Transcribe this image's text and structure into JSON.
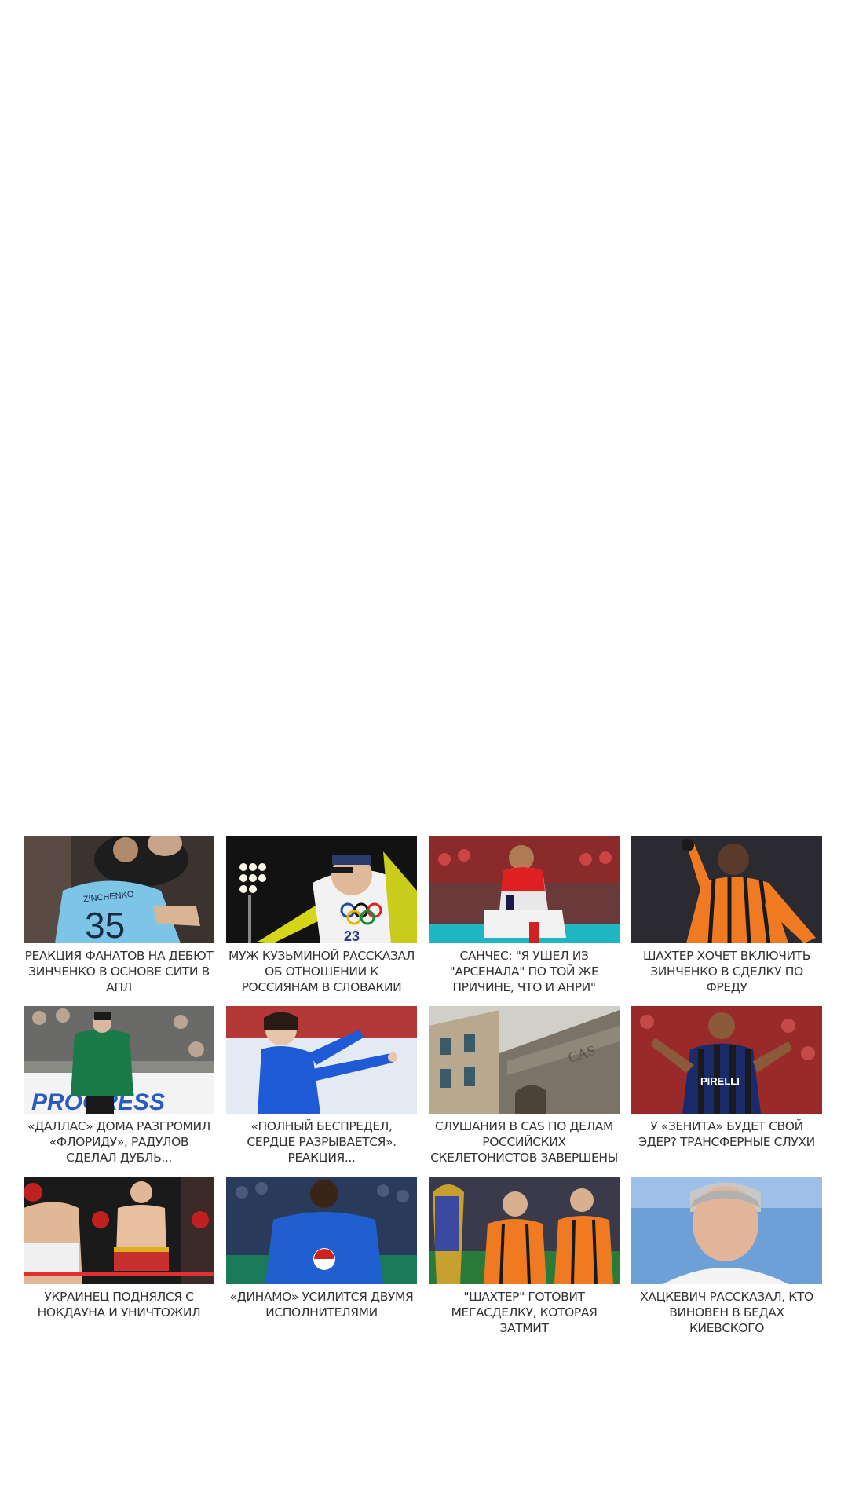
{
  "news": [
    {
      "title": "РЕАКЦИЯ ФАНАТОВ НА ДЕБЮТ ЗИНЧЕНКО В ОСНОВЕ СИТИ В АПЛ",
      "jersey_name": "ZINCHENKO",
      "jersey_number": "35",
      "image_icon": "football-player-photo"
    },
    {
      "title": "МУЖ КУЗЬМИНОЙ РАССКАЗАЛ ОБ ОТНОШЕНИИ К РОССИЯНАМ В СЛОВАКИИ",
      "bib_number": "23",
      "image_icon": "biathlete-photo"
    },
    {
      "title": "САНЧЕС: \"Я УШЕЛ ИЗ \"АРСЕНАЛА\" ПО ТОЙ ЖЕ ПРИЧИНЕ, ЧТО И АНРИ\"",
      "image_icon": "arsenal-player-photo"
    },
    {
      "title": "ШАХТЕР ХОЧЕТ ВКЛЮЧИТЬ ЗИНЧЕНКО В СДЕЛКУ ПО ФРЕДУ",
      "image_icon": "shakhtar-player-photo"
    },
    {
      "title": "«ДАЛЛАС» ДОМА РАЗГРОМИЛ «ФЛОРИДУ», РАДУЛОВ СДЕЛАЛ ДУБЛЬ...",
      "board_text": "PROGRESS",
      "image_icon": "hockey-player-photo"
    },
    {
      "title": "«ПОЛНЫЙ БЕСПРЕДЕЛ, СЕРДЦЕ РАЗРЫВАЕТСЯ». РЕАКЦИЯ...",
      "image_icon": "figure-skater-photo"
    },
    {
      "title": "СЛУШАНИЯ В CAS ПО ДЕЛАМ РОССИЙСКИХ СКЕЛЕТОНИСТОВ ЗАВЕРШЕНЫ",
      "building_sign": "CAS",
      "image_icon": "building-photo"
    },
    {
      "title": "У «ЗЕНИТА» БУДЕТ СВОЙ ЭДЕР? ТРАНСФЕРНЫЕ СЛУХИ",
      "shirt_sponsor": "PIRELLI",
      "image_icon": "inter-player-photo"
    },
    {
      "title": "УКРАИНЕЦ ПОДНЯЛСЯ С НОКДАУНА И УНИЧТОЖИЛ",
      "image_icon": "boxers-photo"
    },
    {
      "title": "«ДИНАМО» УСИЛИТСЯ ДВУМЯ ИСПОЛНИТЕЛЯМИ",
      "image_icon": "blue-kit-player-photo"
    },
    {
      "title": "\"ШАХТЕР\" ГОТОВИТ МЕГАСДЕЛКУ, КОТОРАЯ ЗАТМИТ",
      "image_icon": "trophy-celebration-photo"
    },
    {
      "title": "ХАЦКЕВИЧ РАССКАЗАЛ, КТО ВИНОВЕН В БЕДАХ КИЕВСКОГО",
      "image_icon": "coach-portrait-photo"
    }
  ]
}
